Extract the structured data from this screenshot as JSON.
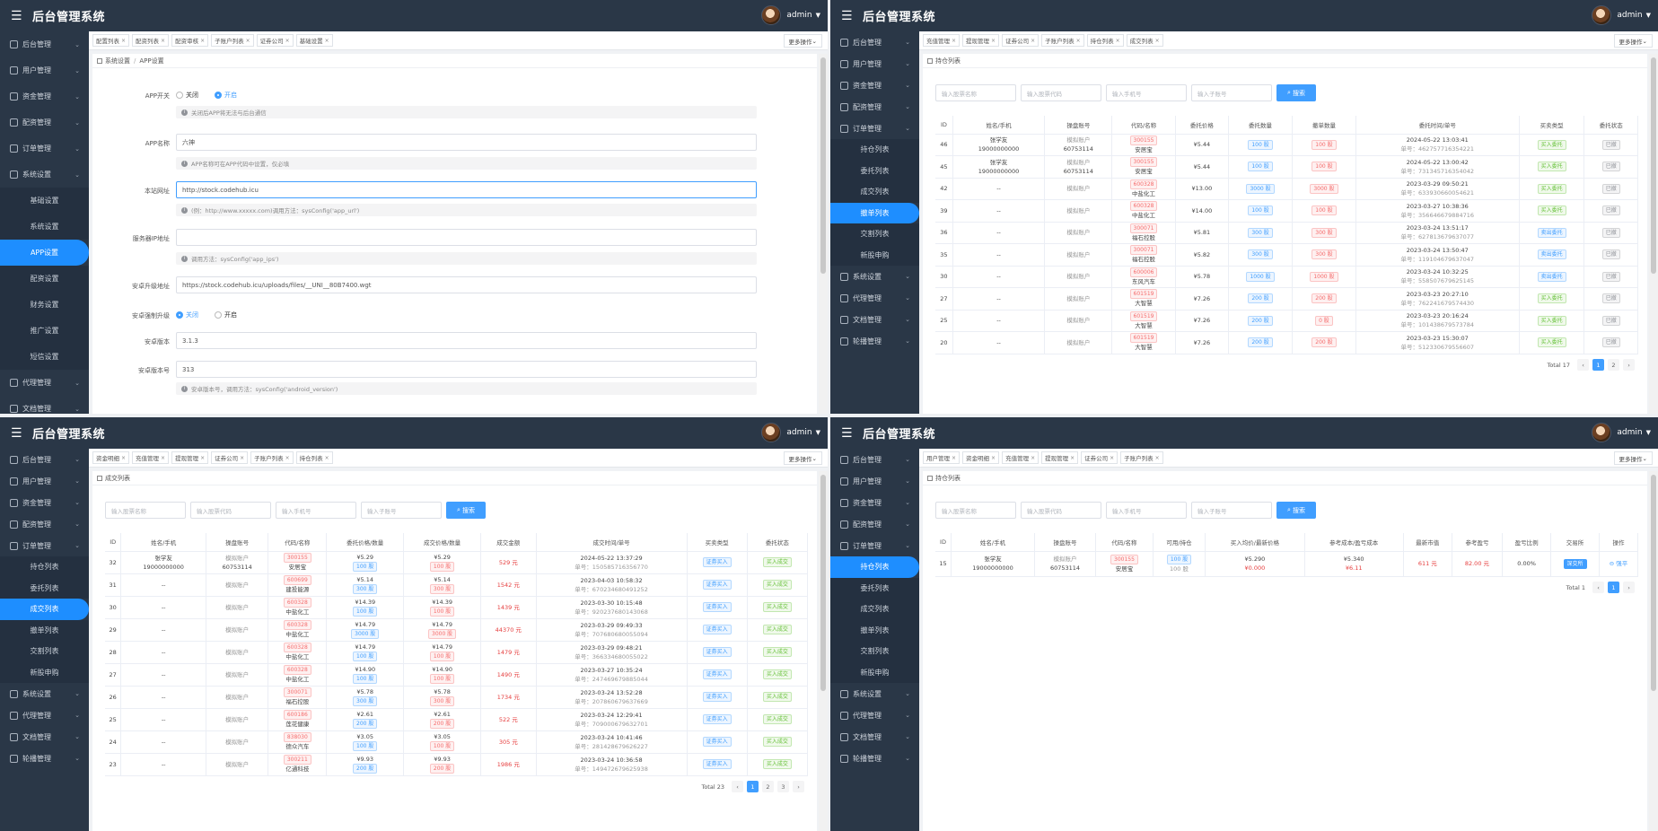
{
  "app": {
    "title": "后台管理系统",
    "user": "admin"
  },
  "tabs_more": "更多操作",
  "search_label": "搜索",
  "filters": [
    "输入股票名称",
    "输入股票代码",
    "输入手机号",
    "输入子账号"
  ],
  "p1": {
    "tabs": [
      "配置列表",
      "配资列表",
      "配资审核",
      "子账户列表",
      "证券公司",
      "基础设置"
    ],
    "breadcrumb": [
      "系统设置",
      "APP设置"
    ],
    "menu": [
      {
        "label": "后台管理",
        "type": "top"
      },
      {
        "label": "用户管理",
        "type": "top"
      },
      {
        "label": "资金管理",
        "type": "top"
      },
      {
        "label": "配资管理",
        "type": "top"
      },
      {
        "label": "订单管理",
        "type": "top"
      },
      {
        "label": "系统设置",
        "type": "top"
      },
      {
        "label": "基础设置",
        "type": "sub"
      },
      {
        "label": "系统设置",
        "type": "sub"
      },
      {
        "label": "APP设置",
        "type": "sub",
        "active": true
      },
      {
        "label": "配资设置",
        "type": "sub"
      },
      {
        "label": "财务设置",
        "type": "sub"
      },
      {
        "label": "推广设置",
        "type": "sub"
      },
      {
        "label": "短信设置",
        "type": "sub"
      },
      {
        "label": "代理管理",
        "type": "top"
      },
      {
        "label": "文档管理",
        "type": "top"
      }
    ],
    "form": {
      "app_switch": {
        "label": "APP开关",
        "off": "关闭",
        "on": "开启",
        "hint": "关闭后APP将无法与后台通信"
      },
      "app_name": {
        "label": "APP名称",
        "value": "六神",
        "hint": "APP名称可在APP代码中设置，仅必填"
      },
      "site_url": {
        "label": "本站网址",
        "value": "http://stock.codehub.icu",
        "hint": "(例：http://www.xxxxx.com)调用方法：sysConfig('app_url')"
      },
      "server_ip": {
        "label": "服务器IP地址",
        "value": "",
        "hint": "调用方法：sysConfig('app_ips')"
      },
      "android_url": {
        "label": "安卓升级地址",
        "value": "https://stock.codehub.icu/uploads/files/__UNI__80B7400.wgt"
      },
      "force_update": {
        "label": "安卓强制升级",
        "off": "关闭",
        "on": "开启"
      },
      "android_version": {
        "label": "安卓版本",
        "value": "3.1.3"
      },
      "android_code": {
        "label": "安卓版本号",
        "value": "313",
        "hint": "安卓版本号，调用方法：sysConfig('android_version')"
      }
    }
  },
  "p2": {
    "tabs": [
      "充值管理",
      "提现管理",
      "证券公司",
      "子账户列表",
      "持仓列表",
      "成交列表"
    ],
    "header": "持仓列表",
    "menu": [
      {
        "label": "后台管理",
        "type": "top"
      },
      {
        "label": "用户管理",
        "type": "top"
      },
      {
        "label": "资金管理",
        "type": "top"
      },
      {
        "label": "配资管理",
        "type": "top"
      },
      {
        "label": "订单管理",
        "type": "top"
      },
      {
        "label": "持仓列表",
        "type": "sub"
      },
      {
        "label": "委托列表",
        "type": "sub"
      },
      {
        "label": "成交列表",
        "type": "sub"
      },
      {
        "label": "撤单列表",
        "type": "sub",
        "active": true
      },
      {
        "label": "交割列表",
        "type": "sub"
      },
      {
        "label": "新股申购",
        "type": "sub"
      },
      {
        "label": "系统设置",
        "type": "top"
      },
      {
        "label": "代理管理",
        "type": "top"
      },
      {
        "label": "文档管理",
        "type": "top"
      },
      {
        "label": "轮播管理",
        "type": "top"
      }
    ],
    "columns": [
      "ID",
      "姓名/手机",
      "操盘账号",
      "代码/名称",
      "委托价格",
      "委托数量",
      "撤单数量",
      "委托时间/单号",
      "买卖类型",
      "委托状态"
    ],
    "rows": [
      {
        "id": "46",
        "name": "张学友",
        "phone": "19000000000",
        "acct": "模拟账户",
        "acct2": "60753114",
        "code": "300155",
        "stock": "安居宝",
        "price": "¥5.44",
        "qty": "100 股",
        "cqty": "100 股",
        "time": "2024-05-22 13:03:41",
        "no": "单号：462757716354221",
        "type": "买入委托",
        "tcls": "green",
        "status": "已撤"
      },
      {
        "id": "45",
        "name": "张学友",
        "phone": "19000000000",
        "acct": "模拟账户",
        "acct2": "60753114",
        "code": "300155",
        "stock": "安居宝",
        "price": "¥5.44",
        "qty": "100 股",
        "cqty": "100 股",
        "time": "2024-05-22 13:00:42",
        "no": "单号：731345716354042",
        "type": "买入委托",
        "tcls": "green",
        "status": "已撤"
      },
      {
        "id": "42",
        "name": "--",
        "phone": "",
        "acct": "模拟账户",
        "acct2": "",
        "code": "600328",
        "stock": "中盐化工",
        "price": "¥13.00",
        "qty": "3000 股",
        "cqty": "3000 股",
        "time": "2023-03-29 09:50:21",
        "no": "单号：633930660054621",
        "type": "买入委托",
        "tcls": "green",
        "status": "已撤"
      },
      {
        "id": "39",
        "name": "--",
        "phone": "",
        "acct": "模拟账户",
        "acct2": "",
        "code": "600328",
        "stock": "中盐化工",
        "price": "¥14.00",
        "qty": "100 股",
        "cqty": "100 股",
        "time": "2023-03-27 10:38:36",
        "no": "单号：356646679884716",
        "type": "买入委托",
        "tcls": "green",
        "status": "已撤"
      },
      {
        "id": "36",
        "name": "--",
        "phone": "",
        "acct": "模拟账户",
        "acct2": "",
        "code": "300071",
        "stock": "福石控股",
        "price": "¥5.81",
        "qty": "300 股",
        "cqty": "300 股",
        "time": "2023-03-24 13:51:17",
        "no": "单号：627813679637077",
        "type": "卖出委托",
        "tcls": "blue",
        "status": "已撤"
      },
      {
        "id": "35",
        "name": "--",
        "phone": "",
        "acct": "模拟账户",
        "acct2": "",
        "code": "300071",
        "stock": "福石控股",
        "price": "¥5.82",
        "qty": "300 股",
        "cqty": "300 股",
        "time": "2023-03-24 13:50:47",
        "no": "单号：119104679637047",
        "type": "卖出委托",
        "tcls": "blue",
        "status": "已撤"
      },
      {
        "id": "30",
        "name": "--",
        "phone": "",
        "acct": "模拟账户",
        "acct2": "",
        "code": "600006",
        "stock": "东风汽车",
        "price": "¥5.78",
        "qty": "1000 股",
        "cqty": "1000 股",
        "time": "2023-03-24 10:32:25",
        "no": "单号：558507679625145",
        "type": "卖出委托",
        "tcls": "blue",
        "status": "已撤"
      },
      {
        "id": "27",
        "name": "--",
        "phone": "",
        "acct": "模拟账户",
        "acct2": "",
        "code": "601519",
        "stock": "大智慧",
        "price": "¥7.26",
        "qty": "200 股",
        "cqty": "200 股",
        "time": "2023-03-23 20:27:10",
        "no": "单号：762241679574430",
        "type": "买入委托",
        "tcls": "green",
        "status": "已撤"
      },
      {
        "id": "25",
        "name": "--",
        "phone": "",
        "acct": "模拟账户",
        "acct2": "",
        "code": "601519",
        "stock": "大智慧",
        "price": "¥7.26",
        "qty": "200 股",
        "cqty": "0 股",
        "time": "2023-03-23 20:16:24",
        "no": "单号：101438679573784",
        "type": "买入委托",
        "tcls": "green",
        "status": "已撤"
      },
      {
        "id": "20",
        "name": "--",
        "phone": "",
        "acct": "模拟账户",
        "acct2": "",
        "code": "601519",
        "stock": "大智慧",
        "price": "¥7.26",
        "qty": "200 股",
        "cqty": "200 股",
        "time": "2023-03-23 15:30:07",
        "no": "单号：512330679556607",
        "type": "买入委托",
        "tcls": "green",
        "status": "已撤"
      }
    ],
    "pager": {
      "total": "Total 17",
      "pages": [
        "1",
        "2"
      ]
    }
  },
  "p3": {
    "tabs": [
      "资金明细",
      "充值管理",
      "提现管理",
      "证券公司",
      "子账户列表",
      "持仓列表"
    ],
    "header": "成交列表",
    "menu": [
      {
        "label": "后台管理",
        "type": "top"
      },
      {
        "label": "用户管理",
        "type": "top"
      },
      {
        "label": "资金管理",
        "type": "top"
      },
      {
        "label": "配资管理",
        "type": "top"
      },
      {
        "label": "订单管理",
        "type": "top"
      },
      {
        "label": "持仓列表",
        "type": "sub"
      },
      {
        "label": "委托列表",
        "type": "sub"
      },
      {
        "label": "成交列表",
        "type": "sub",
        "active": true
      },
      {
        "label": "撤单列表",
        "type": "sub"
      },
      {
        "label": "交割列表",
        "type": "sub"
      },
      {
        "label": "新股申购",
        "type": "sub"
      },
      {
        "label": "系统设置",
        "type": "top"
      },
      {
        "label": "代理管理",
        "type": "top"
      },
      {
        "label": "文档管理",
        "type": "top"
      },
      {
        "label": "轮播管理",
        "type": "top"
      }
    ],
    "columns": [
      "ID",
      "姓名/手机",
      "操盘账号",
      "代码/名称",
      "委托价格/数量",
      "成交价格/数量",
      "成交金额",
      "成交时间/单号",
      "买卖类型",
      "委托状态"
    ],
    "rows": [
      {
        "id": "32",
        "name": "张学友",
        "phone": "19000000000",
        "acct": "模拟账户",
        "acct2": "60753114",
        "code": "300155",
        "stock": "安居宝",
        "p1": "¥5.29",
        "q1": "100 股",
        "p2": "¥5.29",
        "q2": "100 股",
        "amt": "529 元",
        "time": "2024-05-22 13:37:29",
        "no": "单号：150585716356770",
        "type": "证券买入",
        "status": "买入成交"
      },
      {
        "id": "31",
        "name": "--",
        "phone": "",
        "acct": "模拟账户",
        "acct2": "",
        "code": "600699",
        "stock": "建投能源",
        "p1": "¥5.14",
        "q1": "300 股",
        "p2": "¥5.14",
        "q2": "300 股",
        "amt": "1542 元",
        "time": "2023-04-03 10:58:32",
        "no": "单号：670234680491252",
        "type": "证券买入",
        "status": "买入成交"
      },
      {
        "id": "30",
        "name": "--",
        "phone": "",
        "acct": "模拟账户",
        "acct2": "",
        "code": "600328",
        "stock": "中盐化工",
        "p1": "¥14.39",
        "q1": "100 股",
        "p2": "¥14.39",
        "q2": "100 股",
        "amt": "1439 元",
        "time": "2023-03-30 10:15:48",
        "no": "单号：920237680143068",
        "type": "证券买入",
        "status": "买入成交"
      },
      {
        "id": "29",
        "name": "--",
        "phone": "",
        "acct": "模拟账户",
        "acct2": "",
        "code": "600328",
        "stock": "中盐化工",
        "p1": "¥14.79",
        "q1": "3000 股",
        "p2": "¥14.79",
        "q2": "3000 股",
        "amt": "44370 元",
        "time": "2023-03-29 09:49:33",
        "no": "单号：707680680055094",
        "type": "证券买入",
        "status": "买入成交"
      },
      {
        "id": "28",
        "name": "--",
        "phone": "",
        "acct": "模拟账户",
        "acct2": "",
        "code": "600328",
        "stock": "中盐化工",
        "p1": "¥14.79",
        "q1": "100 股",
        "p2": "¥14.79",
        "q2": "100 股",
        "amt": "1479 元",
        "time": "2023-03-29 09:48:21",
        "no": "单号：366334680055022",
        "type": "证券买入",
        "status": "买入成交"
      },
      {
        "id": "27",
        "name": "--",
        "phone": "",
        "acct": "模拟账户",
        "acct2": "",
        "code": "600328",
        "stock": "中盐化工",
        "p1": "¥14.90",
        "q1": "100 股",
        "p2": "¥14.90",
        "q2": "100 股",
        "amt": "1490 元",
        "time": "2023-03-27 10:35:24",
        "no": "单号：247469679885044",
        "type": "证券买入",
        "status": "买入成交"
      },
      {
        "id": "26",
        "name": "--",
        "phone": "",
        "acct": "模拟账户",
        "acct2": "",
        "code": "300071",
        "stock": "福石控股",
        "p1": "¥5.78",
        "q1": "300 股",
        "p2": "¥5.78",
        "q2": "300 股",
        "amt": "1734 元",
        "time": "2023-03-24 13:52:28",
        "no": "单号：207860679637669",
        "type": "证券买入",
        "status": "买入成交"
      },
      {
        "id": "25",
        "name": "--",
        "phone": "",
        "acct": "模拟账户",
        "acct2": "",
        "code": "600186",
        "stock": "莲花健康",
        "p1": "¥2.61",
        "q1": "200 股",
        "p2": "¥2.61",
        "q2": "200 股",
        "amt": "522 元",
        "time": "2023-03-24 12:29:41",
        "no": "单号：709000679632701",
        "type": "证券买入",
        "status": "买入成交"
      },
      {
        "id": "24",
        "name": "--",
        "phone": "",
        "acct": "模拟账户",
        "acct2": "",
        "code": "838030",
        "stock": "德众汽车",
        "p1": "¥3.05",
        "q1": "100 股",
        "p2": "¥3.05",
        "q2": "100 股",
        "amt": "305 元",
        "time": "2023-03-24 10:41:46",
        "no": "单号：281428679626227",
        "type": "证券买入",
        "status": "买入成交"
      },
      {
        "id": "23",
        "name": "--",
        "phone": "",
        "acct": "模拟账户",
        "acct2": "",
        "code": "300211",
        "stock": "亿通科技",
        "p1": "¥9.93",
        "q1": "200 股",
        "p2": "¥9.93",
        "q2": "200 股",
        "amt": "1986 元",
        "time": "2023-03-24 10:36:58",
        "no": "单号：149472679625938",
        "type": "证券买入",
        "status": "买入成交"
      }
    ],
    "pager": {
      "total": "Total 23",
      "pages": [
        "1",
        "2",
        "3"
      ]
    }
  },
  "p4": {
    "tabs": [
      "用户管理",
      "资金明细",
      "充值管理",
      "提现管理",
      "证券公司",
      "子账户列表"
    ],
    "header": "持仓列表",
    "menu": [
      {
        "label": "后台管理",
        "type": "top"
      },
      {
        "label": "用户管理",
        "type": "top"
      },
      {
        "label": "资金管理",
        "type": "top"
      },
      {
        "label": "配资管理",
        "type": "top"
      },
      {
        "label": "订单管理",
        "type": "top"
      },
      {
        "label": "持仓列表",
        "type": "sub",
        "active": true
      },
      {
        "label": "委托列表",
        "type": "sub"
      },
      {
        "label": "成交列表",
        "type": "sub"
      },
      {
        "label": "撤单列表",
        "type": "sub"
      },
      {
        "label": "交割列表",
        "type": "sub"
      },
      {
        "label": "新股申购",
        "type": "sub"
      },
      {
        "label": "系统设置",
        "type": "top"
      },
      {
        "label": "代理管理",
        "type": "top"
      },
      {
        "label": "文档管理",
        "type": "top"
      },
      {
        "label": "轮播管理",
        "type": "top"
      }
    ],
    "columns": [
      "ID",
      "姓名/手机",
      "操盘账号",
      "代码/名称",
      "可用/持仓",
      "买入均价/最新价格",
      "参考成本/盈亏成本",
      "最新市值",
      "参考盈亏",
      "盈亏比例",
      "交易所",
      "操作"
    ],
    "rows": [
      {
        "id": "15",
        "name": "张学友",
        "phone": "19000000000",
        "acct": "模拟账户",
        "acct2": "60753114",
        "code": "300155",
        "stock": "安居宝",
        "avail": "100 股",
        "hold": "100 股",
        "buy": "¥5.290",
        "last": "¥0.000",
        "cost": "¥5.340",
        "pcost": "¥6.11",
        "mv": "611 元",
        "pnl": "82.00 元",
        "ratio": "0.00%",
        "ex": "深交所",
        "op": "强平"
      }
    ],
    "pager": {
      "total": "Total 1",
      "pages": [
        "1"
      ]
    }
  }
}
